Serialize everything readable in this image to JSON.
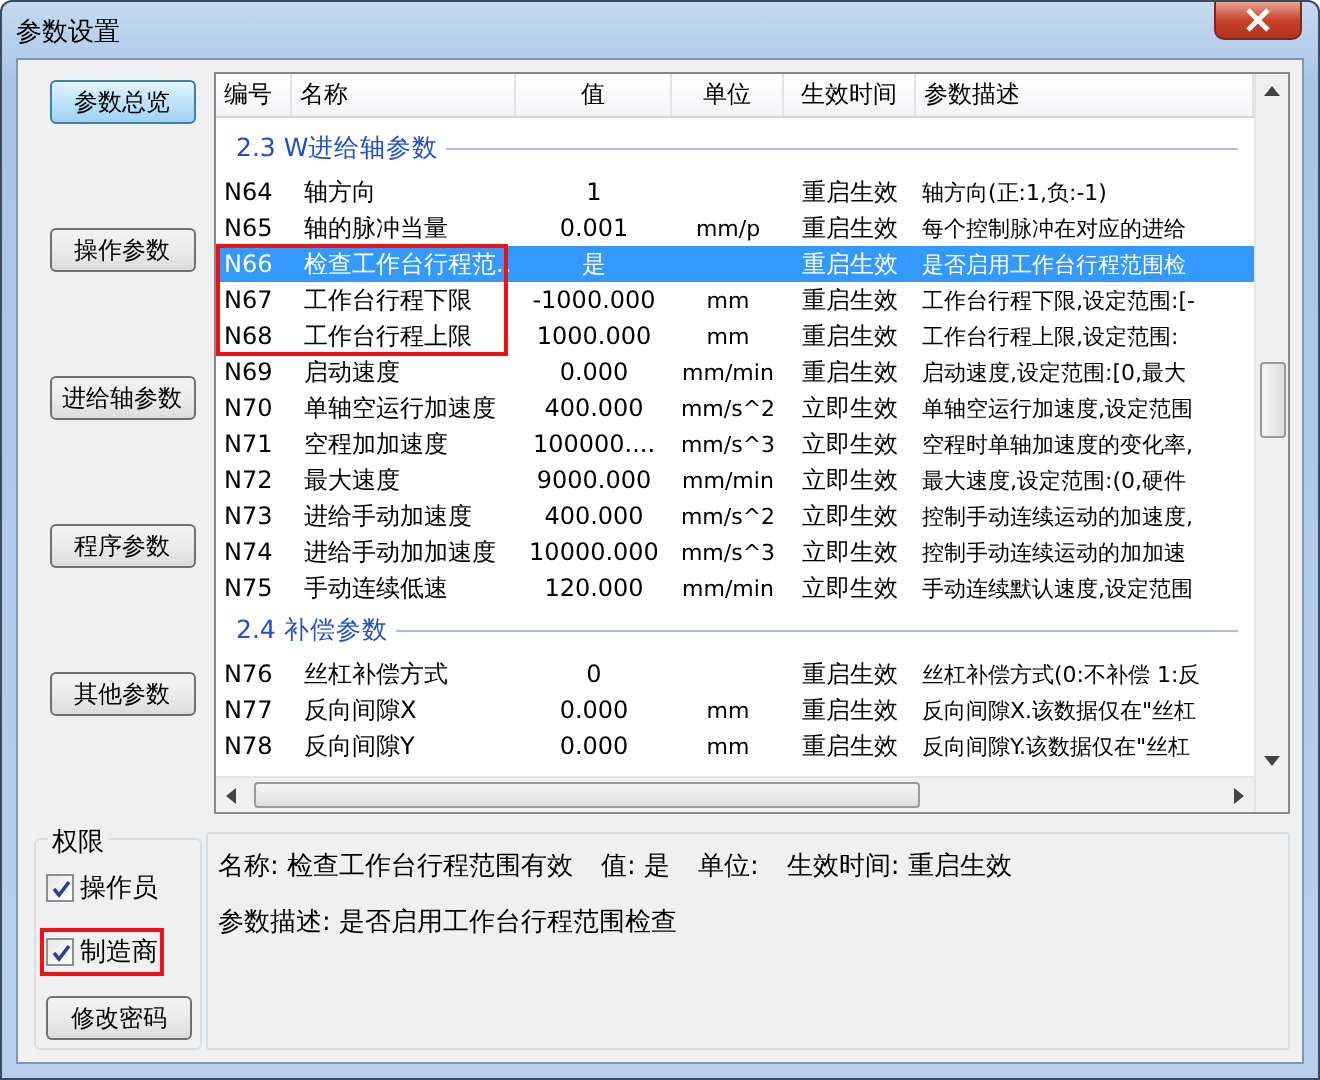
{
  "window": {
    "title": "参数设置"
  },
  "nav_buttons": [
    {
      "label": "参数总览",
      "selected": true
    },
    {
      "label": "操作参数",
      "selected": false
    },
    {
      "label": "进给轴参数",
      "selected": false
    },
    {
      "label": "程序参数",
      "selected": false
    },
    {
      "label": "其他参数",
      "selected": false
    }
  ],
  "table": {
    "columns": [
      "编号",
      "名称",
      "值",
      "单位",
      "生效时间",
      "参数描述"
    ],
    "rows": [
      {
        "kind": "group",
        "label": "2.3 W进给轴参数"
      },
      {
        "kind": "row",
        "cells": [
          "N64",
          "轴方向",
          "1",
          "",
          "重启生效",
          "轴方向(正:1,负:-1)"
        ],
        "selected": false,
        "marked": false
      },
      {
        "kind": "row",
        "cells": [
          "N65",
          "轴的脉冲当量",
          "0.001",
          "mm/p",
          "重启生效",
          "每个控制脉冲在对应的进给"
        ],
        "selected": false,
        "marked": false
      },
      {
        "kind": "row",
        "cells": [
          "N66",
          "检查工作台行程范..",
          "是",
          "",
          "重启生效",
          "是否启用工作台行程范围检"
        ],
        "selected": true,
        "marked": true
      },
      {
        "kind": "row",
        "cells": [
          "N67",
          "工作台行程下限",
          "-1000.000",
          "mm",
          "重启生效",
          "工作台行程下限,设定范围:[-"
        ],
        "selected": false,
        "marked": true
      },
      {
        "kind": "row",
        "cells": [
          "N68",
          "工作台行程上限",
          "1000.000",
          "mm",
          "重启生效",
          "工作台行程上限,设定范围:"
        ],
        "selected": false,
        "marked": true
      },
      {
        "kind": "row",
        "cells": [
          "N69",
          "启动速度",
          "0.000",
          "mm/min",
          "重启生效",
          "启动速度,设定范围:[0,最大"
        ],
        "selected": false,
        "marked": false
      },
      {
        "kind": "row",
        "cells": [
          "N70",
          "单轴空运行加速度",
          "400.000",
          "mm/s^2",
          "立即生效",
          "单轴空运行加速度,设定范围"
        ],
        "selected": false,
        "marked": false
      },
      {
        "kind": "row",
        "cells": [
          "N71",
          "空程加加速度",
          "100000....",
          "mm/s^3",
          "立即生效",
          "空程时单轴加速度的变化率,"
        ],
        "selected": false,
        "marked": false
      },
      {
        "kind": "row",
        "cells": [
          "N72",
          "最大速度",
          "9000.000",
          "mm/min",
          "立即生效",
          "最大速度,设定范围:(0,硬件"
        ],
        "selected": false,
        "marked": false
      },
      {
        "kind": "row",
        "cells": [
          "N73",
          "进给手动加速度",
          "400.000",
          "mm/s^2",
          "立即生效",
          "控制手动连续运动的加速度,"
        ],
        "selected": false,
        "marked": false
      },
      {
        "kind": "row",
        "cells": [
          "N74",
          "进给手动加加速度",
          "10000.000",
          "mm/s^3",
          "立即生效",
          "控制手动连续运动的加加速"
        ],
        "selected": false,
        "marked": false
      },
      {
        "kind": "row",
        "cells": [
          "N75",
          "手动连续低速",
          "120.000",
          "mm/min",
          "立即生效",
          "手动连续默认速度,设定范围"
        ],
        "selected": false,
        "marked": false
      },
      {
        "kind": "group",
        "label": "2.4 补偿参数"
      },
      {
        "kind": "row",
        "cells": [
          "N76",
          "丝杠补偿方式",
          "0",
          "",
          "重启生效",
          "丝杠补偿方式(0:不补偿 1:反"
        ],
        "selected": false,
        "marked": false
      },
      {
        "kind": "row",
        "cells": [
          "N77",
          "反向间隙X",
          "0.000",
          "mm",
          "重启生效",
          "反向间隙X.该数据仅在\"丝杠"
        ],
        "selected": false,
        "marked": false
      },
      {
        "kind": "row",
        "cells": [
          "N78",
          "反向间隙Y",
          "0.000",
          "mm",
          "重启生效",
          "反向间隙Y.该数据仅在\"丝杠"
        ],
        "selected": false,
        "marked": false
      }
    ]
  },
  "permissions": {
    "title": "权限",
    "options": [
      {
        "label": "操作员",
        "checked": true,
        "marked": false
      },
      {
        "label": "制造商",
        "checked": true,
        "marked": true
      }
    ],
    "button": "修改密码"
  },
  "details": {
    "fields": [
      "名称: 检查工作台行程范围有效",
      "值: 是",
      "单位:",
      "生效时间: 重启生效"
    ],
    "description": "参数描述: 是否启用工作台行程范围检查"
  }
}
